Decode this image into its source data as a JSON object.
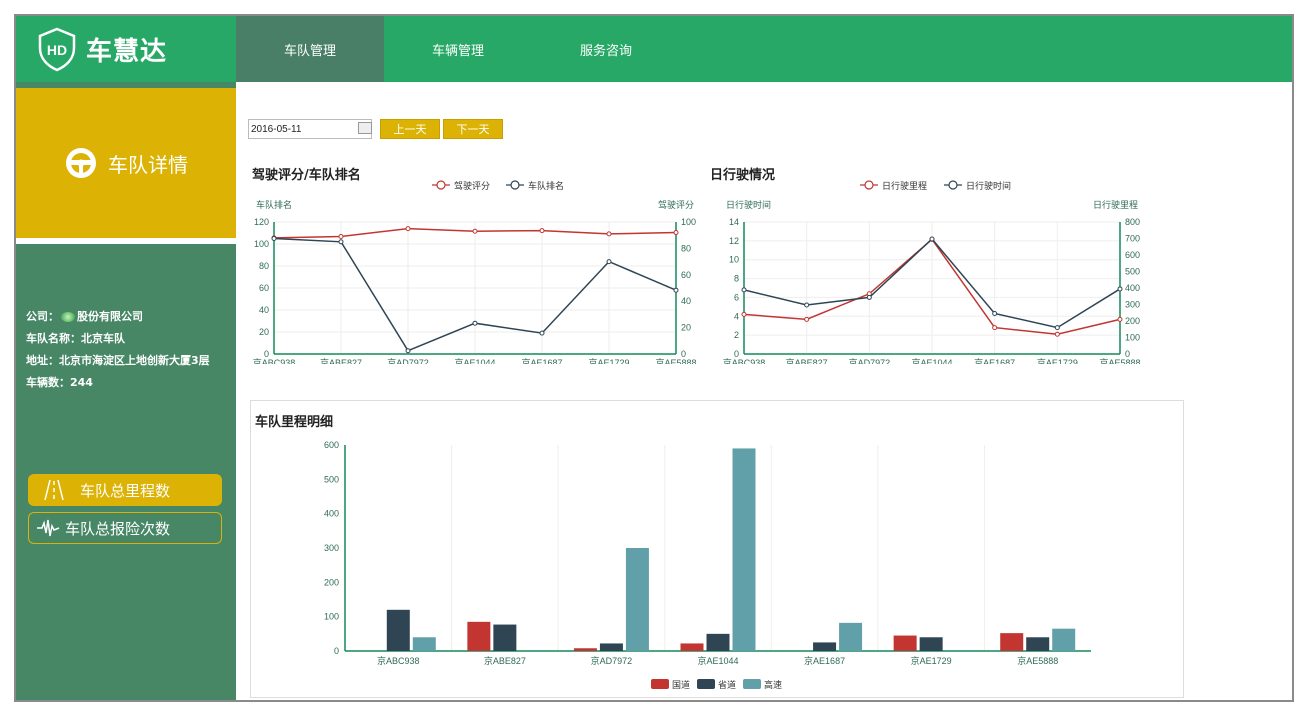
{
  "app": {
    "brand": "车慧达"
  },
  "nav": {
    "tabs": [
      "车队管理",
      "车辆管理",
      "服务咨询"
    ],
    "active": 0
  },
  "sidebar": {
    "title": "车队详情",
    "company_label": "公司：",
    "company_value": "股份有限公司",
    "fleet_label": "车队名称：",
    "fleet_value": "北京车队",
    "address_label": "地址：",
    "address_value": "北京市海淀区上地创新大厦3层",
    "vehicles_label": "车辆数：",
    "vehicles_value": "244",
    "btn_mileage": "车队总里程数",
    "btn_insurance": "车队总报险次数"
  },
  "toolbar": {
    "date": "2016-05-11",
    "prev_label": "上一天",
    "next_label": "下一天"
  },
  "colors": {
    "green": "#27a866",
    "dark_green": "#478766",
    "gold": "#dcb304",
    "red": "#c23531",
    "navy": "#2f4554",
    "teal": "#61a0a8"
  },
  "chart_data": [
    {
      "type": "line",
      "title": "驾驶评分/车队排名",
      "categories": [
        "京ABC938",
        "京ABE827",
        "京AD7972",
        "京AE1044",
        "京AE1687",
        "京AE1729",
        "京AE5888"
      ],
      "series": [
        {
          "name": "驾驶评分",
          "axis": "right",
          "color": "#c23531",
          "values": [
            88,
            89,
            95,
            93,
            93.5,
            91,
            92
          ]
        },
        {
          "name": "车队排名",
          "axis": "left",
          "color": "#2f4554",
          "values": [
            105,
            102,
            3,
            28,
            19,
            84,
            58
          ]
        }
      ],
      "ylabel_left": "车队排名",
      "ylim_left": [
        0,
        120
      ],
      "ticks_left": [
        0,
        20,
        40,
        60,
        80,
        100,
        120
      ],
      "ylabel_right": "驾驶评分",
      "ylim_right": [
        0,
        100
      ],
      "ticks_right": [
        0,
        20,
        40,
        60,
        80,
        100
      ],
      "legend": "top"
    },
    {
      "type": "line",
      "title": "日行驶情况",
      "categories": [
        "京ABC938",
        "京ABE827",
        "京AD7972",
        "京AE1044",
        "京AE1687",
        "京AE1729",
        "京AE5888"
      ],
      "series": [
        {
          "name": "日行驶里程",
          "axis": "right",
          "color": "#c23531",
          "values": [
            240,
            210,
            365,
            695,
            160,
            120,
            210
          ]
        },
        {
          "name": "日行驶时间",
          "axis": "left",
          "color": "#2f4554",
          "values": [
            6.8,
            5.2,
            6,
            12.2,
            4.3,
            2.8,
            6.9
          ]
        }
      ],
      "ylabel_left": "日行驶时间",
      "ylim_left": [
        0,
        14
      ],
      "ticks_left": [
        0,
        2,
        4,
        6,
        8,
        10,
        12,
        14
      ],
      "ylabel_right": "日行驶里程",
      "ylim_right": [
        0,
        800
      ],
      "ticks_right": [
        0,
        100,
        200,
        300,
        400,
        500,
        600,
        700,
        800
      ],
      "legend": "top"
    },
    {
      "type": "bar",
      "title": "车队里程明细",
      "categories": [
        "京ABC938",
        "京ABE827",
        "京AD7972",
        "京AE1044",
        "京AE1687",
        "京AE1729",
        "京AE5888"
      ],
      "series": [
        {
          "name": "国道",
          "color": "#c23531",
          "values": [
            0,
            85,
            8,
            22,
            0,
            45,
            52
          ]
        },
        {
          "name": "省道",
          "color": "#2f4554",
          "values": [
            120,
            77,
            22,
            50,
            25,
            40,
            40
          ]
        },
        {
          "name": "高速",
          "color": "#61a0a8",
          "values": [
            40,
            0,
            300,
            590,
            82,
            0,
            65
          ]
        }
      ],
      "ylim": [
        0,
        600
      ],
      "ticks": [
        0,
        100,
        200,
        300,
        400,
        500,
        600
      ],
      "legend": "bottom"
    }
  ]
}
